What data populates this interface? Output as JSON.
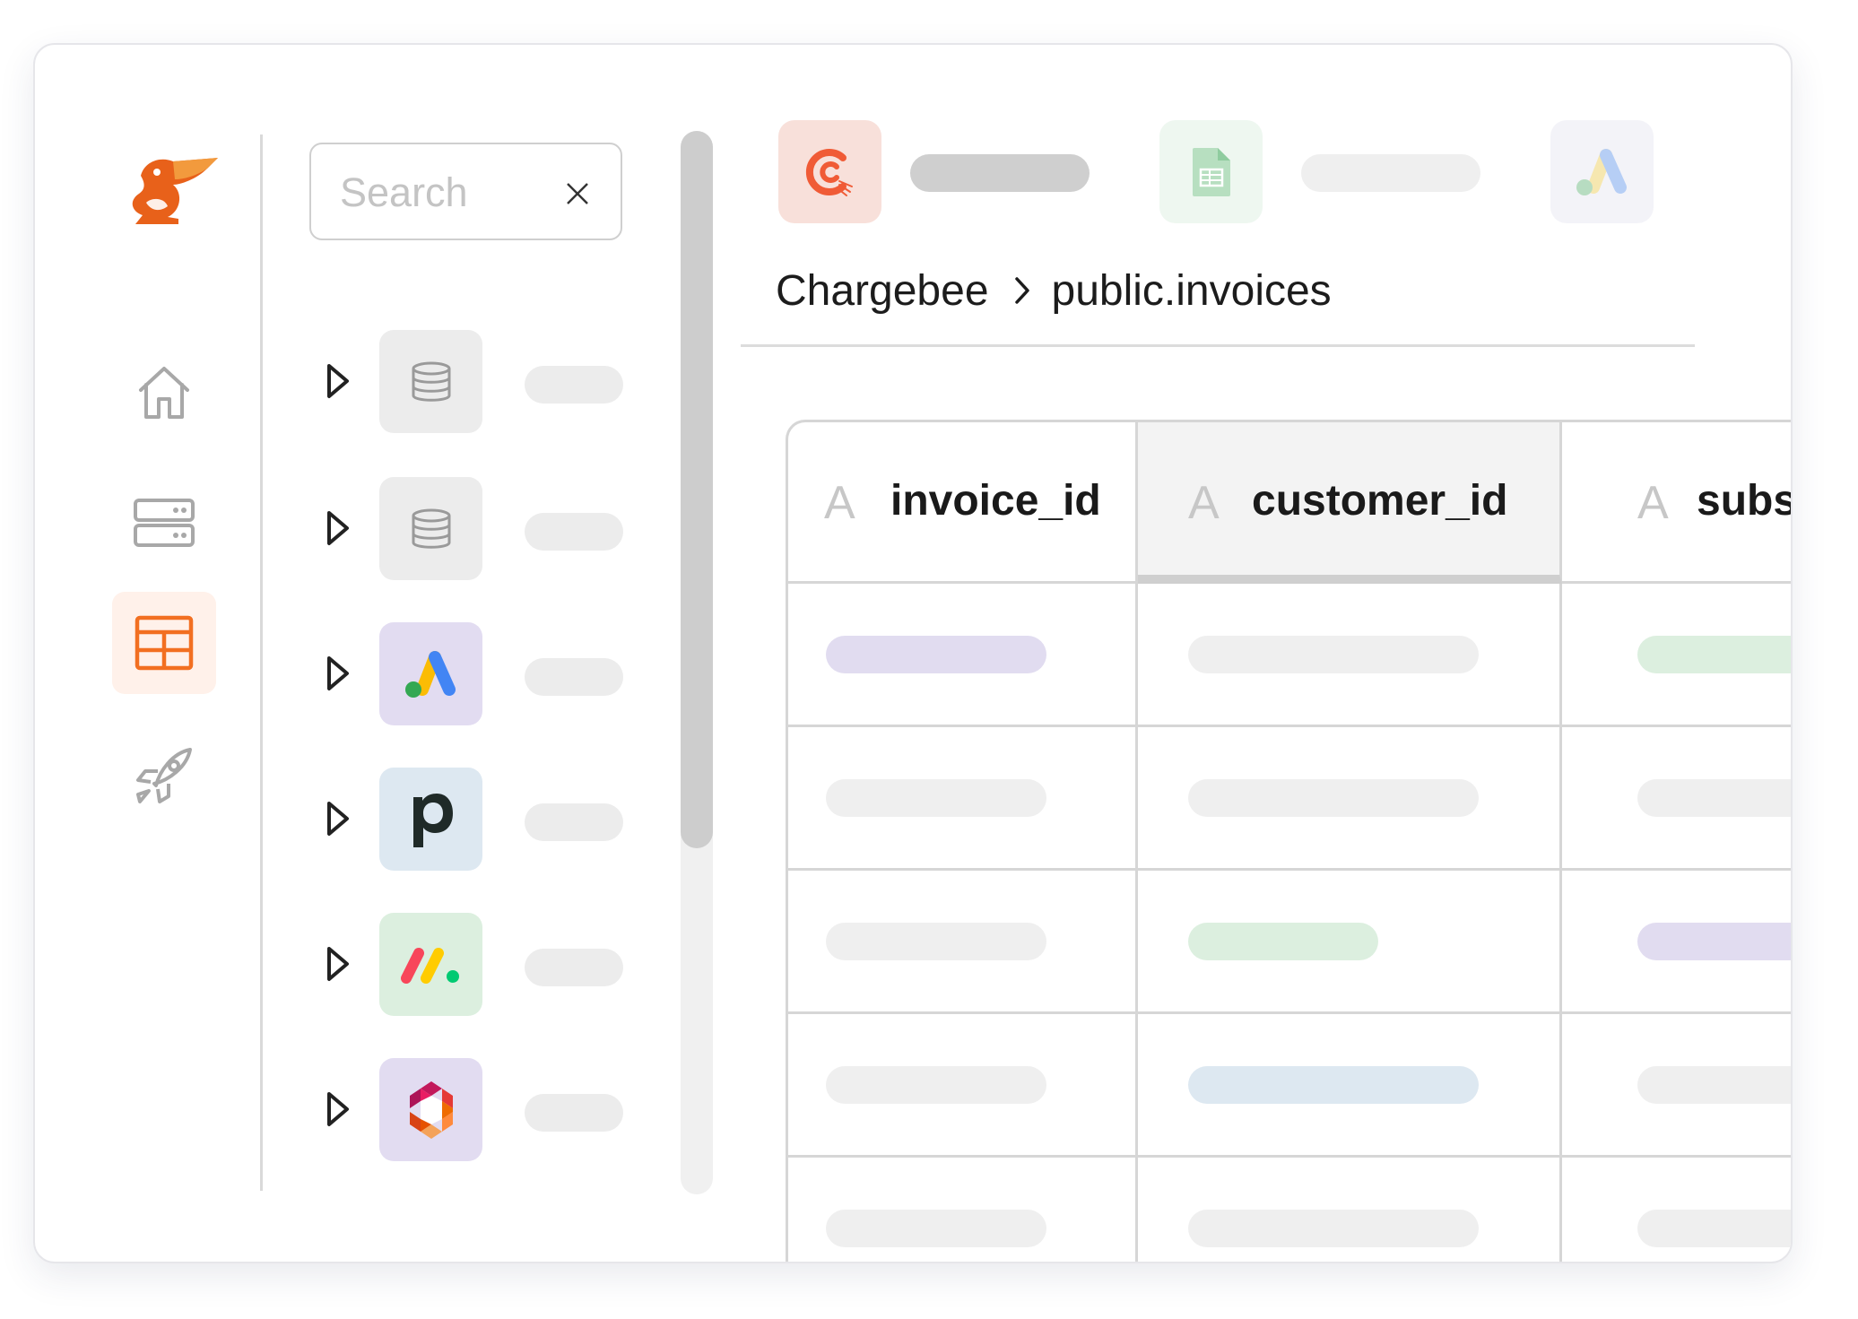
{
  "colors": {
    "accent": "#f26f21",
    "active_nav_bg": "#fff1ea",
    "placeholder_purple": "#e1dcf0",
    "placeholder_green": "#dcefdf",
    "placeholder_blue": "#dde8f1",
    "placeholder_gray": "#efefef"
  },
  "nav": {
    "items": [
      {
        "icon": "home-icon",
        "active": false
      },
      {
        "icon": "server-icon",
        "active": false
      },
      {
        "icon": "table-icon",
        "active": true
      },
      {
        "icon": "rocket-icon",
        "active": false
      }
    ]
  },
  "search": {
    "placeholder": "Search",
    "value": ""
  },
  "sources": [
    {
      "icon": "database-icon"
    },
    {
      "icon": "database-icon"
    },
    {
      "icon": "google-ads-icon"
    },
    {
      "icon": "pipedrive-icon"
    },
    {
      "icon": "monday-icon"
    },
    {
      "icon": "hexagon-logo-icon"
    }
  ],
  "app_tabs": [
    {
      "icon": "chargebee-icon"
    },
    {
      "icon": "google-sheets-icon"
    },
    {
      "icon": "google-ads-icon"
    }
  ],
  "breadcrumb": {
    "source": "Chargebee",
    "table": "public.invoices"
  },
  "table": {
    "columns": [
      {
        "type_glyph": "A",
        "name": "invoice_id"
      },
      {
        "type_glyph": "A",
        "name": "customer_id"
      },
      {
        "type_glyph": "A",
        "name": "subs"
      }
    ],
    "selected_column": "customer_id"
  }
}
